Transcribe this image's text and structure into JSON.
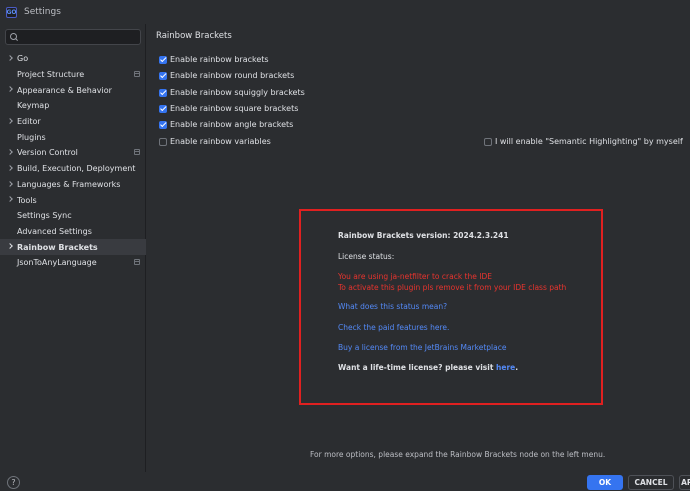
{
  "window": {
    "app_icon": "GO",
    "title": "Settings"
  },
  "sidebar": {
    "search_placeholder": "",
    "items": [
      {
        "label": "Go",
        "chevron": true,
        "page_icon": false
      },
      {
        "label": "Project Structure",
        "chevron": false,
        "page_icon": true
      },
      {
        "label": "Appearance & Behavior",
        "chevron": true,
        "page_icon": false
      },
      {
        "label": "Keymap",
        "chevron": false,
        "page_icon": false
      },
      {
        "label": "Editor",
        "chevron": true,
        "page_icon": false
      },
      {
        "label": "Plugins",
        "chevron": false,
        "page_icon": false
      },
      {
        "label": "Version Control",
        "chevron": true,
        "page_icon": true
      },
      {
        "label": "Build, Execution, Deployment",
        "chevron": true,
        "page_icon": false
      },
      {
        "label": "Languages & Frameworks",
        "chevron": true,
        "page_icon": false
      },
      {
        "label": "Tools",
        "chevron": true,
        "page_icon": false
      },
      {
        "label": "Settings Sync",
        "chevron": false,
        "page_icon": false
      },
      {
        "label": "Advanced Settings",
        "chevron": false,
        "page_icon": false
      },
      {
        "label": "Rainbow Brackets",
        "chevron": true,
        "page_icon": false,
        "selected": true
      },
      {
        "label": "JsonToAnyLanguage",
        "chevron": false,
        "page_icon": true
      }
    ]
  },
  "main": {
    "title": "Rainbow Brackets",
    "options": [
      {
        "label": "Enable rainbow brackets",
        "checked": true
      },
      {
        "label": "Enable rainbow round brackets",
        "checked": true
      },
      {
        "label": "Enable rainbow squiggly brackets",
        "checked": true
      },
      {
        "label": "Enable rainbow square brackets",
        "checked": true
      },
      {
        "label": "Enable rainbow angle brackets",
        "checked": true
      },
      {
        "label": "Enable rainbow variables",
        "checked": false
      }
    ],
    "semantic_option": {
      "label": "I will enable \"Semantic Highlighting\" by myself",
      "checked": false
    },
    "license": {
      "version": "Rainbow Brackets version: 2024.2.3.241",
      "status_label": "License status:",
      "warning_line1": "You are using ja-netfilter to crack the IDE",
      "warning_line2": "To activate this plugin pls remove it from your IDE class path",
      "link_status": "What does this status mean?",
      "link_features": "Check the paid features here.",
      "link_buy": "Buy a license from the JetBrains Marketplace",
      "lifetime_text": "Want a life-time license? please visit ",
      "lifetime_link": "here",
      "lifetime_end": "."
    },
    "footer_note": "For more options, please expand the Rainbow Brackets node on the left menu."
  },
  "buttons": {
    "help": "?",
    "ok": "OK",
    "cancel": "CANCEL",
    "apply": "APPLY"
  },
  "colors": {
    "accent": "#3574f0",
    "warning": "#e8342e",
    "link": "#548af7",
    "highlight_border": "#e02020"
  }
}
